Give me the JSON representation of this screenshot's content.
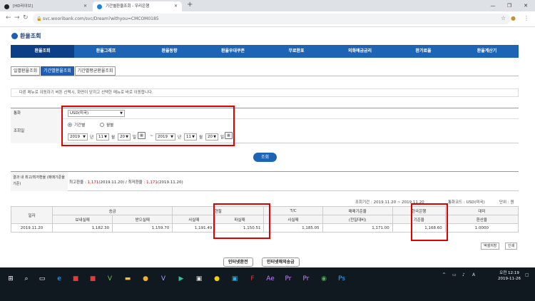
{
  "browser": {
    "tabs": [
      {
        "title": "[HD라이브]",
        "active": false
      },
      {
        "title": "기간별환율조회 - 우리은행",
        "active": true
      }
    ],
    "url": "svc.wooribank.com/svc/Dream?withyou=CMCOM0185"
  },
  "page": {
    "logo": "환율조회",
    "nav": [
      "환율조회",
      "환율그래프",
      "환율동향",
      "환율우대쿠폰",
      "무료환표",
      "외화예금금리",
      "환가료율",
      "환율계산기"
    ],
    "subtabs": [
      "일별환율조회",
      "기간별환율조회",
      "기간별평균환율조회"
    ],
    "notice": "다른 메뉴로 이동하기 버튼 선택시, 화면이 닫히고 선택한 메뉴로 바로 이동합니다.",
    "form": {
      "currency_label": "통화",
      "currency_value": "USD(미국)",
      "period_label": "조회일",
      "radio_period": "기간별",
      "radio_monthly": "월별",
      "from": {
        "year": "2019",
        "month": "11",
        "day": "20"
      },
      "to": {
        "year": "2019",
        "month": "11",
        "day": "20"
      },
      "unit_year": "년",
      "unit_month": "월",
      "unit_day": "일",
      "tilde": "~"
    },
    "search_button": "조회",
    "result": {
      "label": "결과 내 최고/최저환율 (매매기준율기준)",
      "max_prefix": "최고환율 :",
      "max_value": "1,171",
      "max_date": "(2019.11.20)",
      "sep": "/ 최저환율 :",
      "min_value": "1,171",
      "min_date": "(2019.11.20)"
    },
    "meta": {
      "period": "조회기간 : 2019.11.20 ~ 2019.11.20",
      "currency": "통화코드 : USD(미국)",
      "unit": "단위 : 원"
    },
    "table": {
      "h_date": "일자",
      "h_remit": "송금",
      "h_send": "보내실때",
      "h_receive": "받으실때",
      "h_cash": "현찰",
      "h_buy": "사실때",
      "h_sell": "파실때",
      "h_tc": "T/C",
      "h_tc_buy": "사실때",
      "h_base": "매매기준율",
      "h_base2": "(전일대비)",
      "h_bok": "한국은행",
      "h_bok2": "기준율",
      "h_usd": "대미",
      "h_usd2": "환산율",
      "row": {
        "date": "2019.11.20",
        "send": "1,182.30",
        "receive": "1,159.70",
        "cash_buy": "1,191.49",
        "cash_sell": "1,150.51",
        "tc_buy": "1,185.05",
        "base": "1,171.00",
        "bok": "1,168.60",
        "usd": "1.0000"
      }
    },
    "excel_button": "엑셀저장",
    "print_button": "인쇄",
    "internet_exchange": "인터넷환전",
    "internet_remit": "인터넷해외송금"
  },
  "taskbar": {
    "time": "오전 12:19",
    "date": "2019-11-26"
  }
}
